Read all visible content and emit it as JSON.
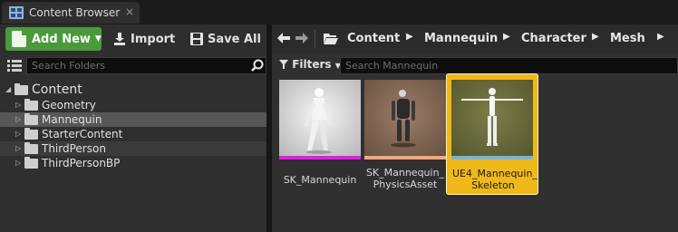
{
  "tab": {
    "title": "Content Browser",
    "close": "×"
  },
  "toolbar": {
    "add_new": "Add New",
    "import": "Import",
    "save_all": "Save All"
  },
  "breadcrumb": [
    "Content",
    "Mannequin",
    "Character",
    "Mesh"
  ],
  "left": {
    "search_placeholder": "Search Folders",
    "tree": [
      {
        "label": "Content",
        "expanded": true
      },
      {
        "label": "Geometry"
      },
      {
        "label": "Mannequin",
        "selected": true
      },
      {
        "label": "StarterContent"
      },
      {
        "label": "ThirdPerson"
      },
      {
        "label": "ThirdPersonBP"
      }
    ]
  },
  "right": {
    "filters_label": "Filters",
    "search_placeholder": "Search Mannequin",
    "assets": [
      {
        "name": "SK_Mannequin",
        "strip_color": "#e01fe0"
      },
      {
        "name": "SK_Mannequin_PhysicsAsset",
        "line1": "SK_Mannequin_",
        "line2": "PhysicsAsset",
        "strip_color": "#f0a882"
      },
      {
        "name": "UE4_Mannequin_Skeleton",
        "line1": "UE4_Mannequin_",
        "line2": "Skeleton",
        "strip_color": "#79b3d6",
        "selected": true
      }
    ]
  },
  "colors": {
    "accent_green": "#4a9a3a",
    "selection": "#f1b81a"
  }
}
